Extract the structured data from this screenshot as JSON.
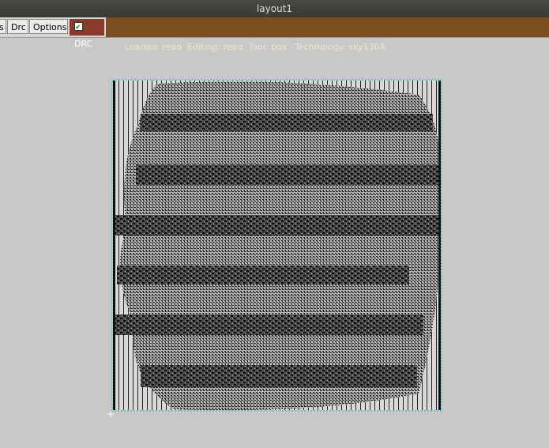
{
  "window": {
    "title": "layout1"
  },
  "toolbar": {
    "prev_button_label": "s",
    "drc_button_label": "Drc",
    "options_button_label": "Options",
    "drc_toggle_label": "DRC"
  },
  "status": {
    "text": "Loaded: read  Editing: read  Tool: box   Technology: sky130A"
  },
  "colors": {
    "status_bg": "#7a4e1f",
    "drc_toggle_bg": "#8a3a28",
    "canvas_bg": "#c8c8c8",
    "cell_boundary": "#00c8c8"
  },
  "icons": [
    "checkbox-checked-icon",
    "origin-cross-icon"
  ]
}
